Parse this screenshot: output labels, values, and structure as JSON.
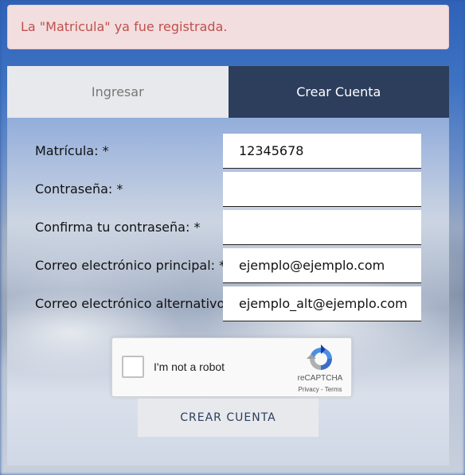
{
  "alert": {
    "message": "La \"Matricula\" ya fue registrada.",
    "color": "#c0504d"
  },
  "tabs": [
    {
      "label": "Ingresar",
      "active": false
    },
    {
      "label": "Crear Cuenta",
      "active": true
    }
  ],
  "form": {
    "fields": [
      {
        "label": "Matrícula: *",
        "value": "12345678"
      },
      {
        "label": "Contraseña: *",
        "value": ""
      },
      {
        "label": "Confirma tu contraseña: *",
        "value": ""
      },
      {
        "label": "Correo electrónico principal: *",
        "value": "ejemplo@ejemplo.com"
      },
      {
        "label": "Correo electrónico alternativo:",
        "value": "ejemplo_alt@ejemplo.com"
      }
    ],
    "recaptcha": {
      "checkbox_label": "I'm not a robot",
      "brand": "reCAPTCHA",
      "links": "Privacy - Terms"
    },
    "submit_label": "CREAR CUENTA"
  },
  "colors": {
    "accent": "#2c3e5c",
    "tab_inactive": "#e8e9ec"
  }
}
